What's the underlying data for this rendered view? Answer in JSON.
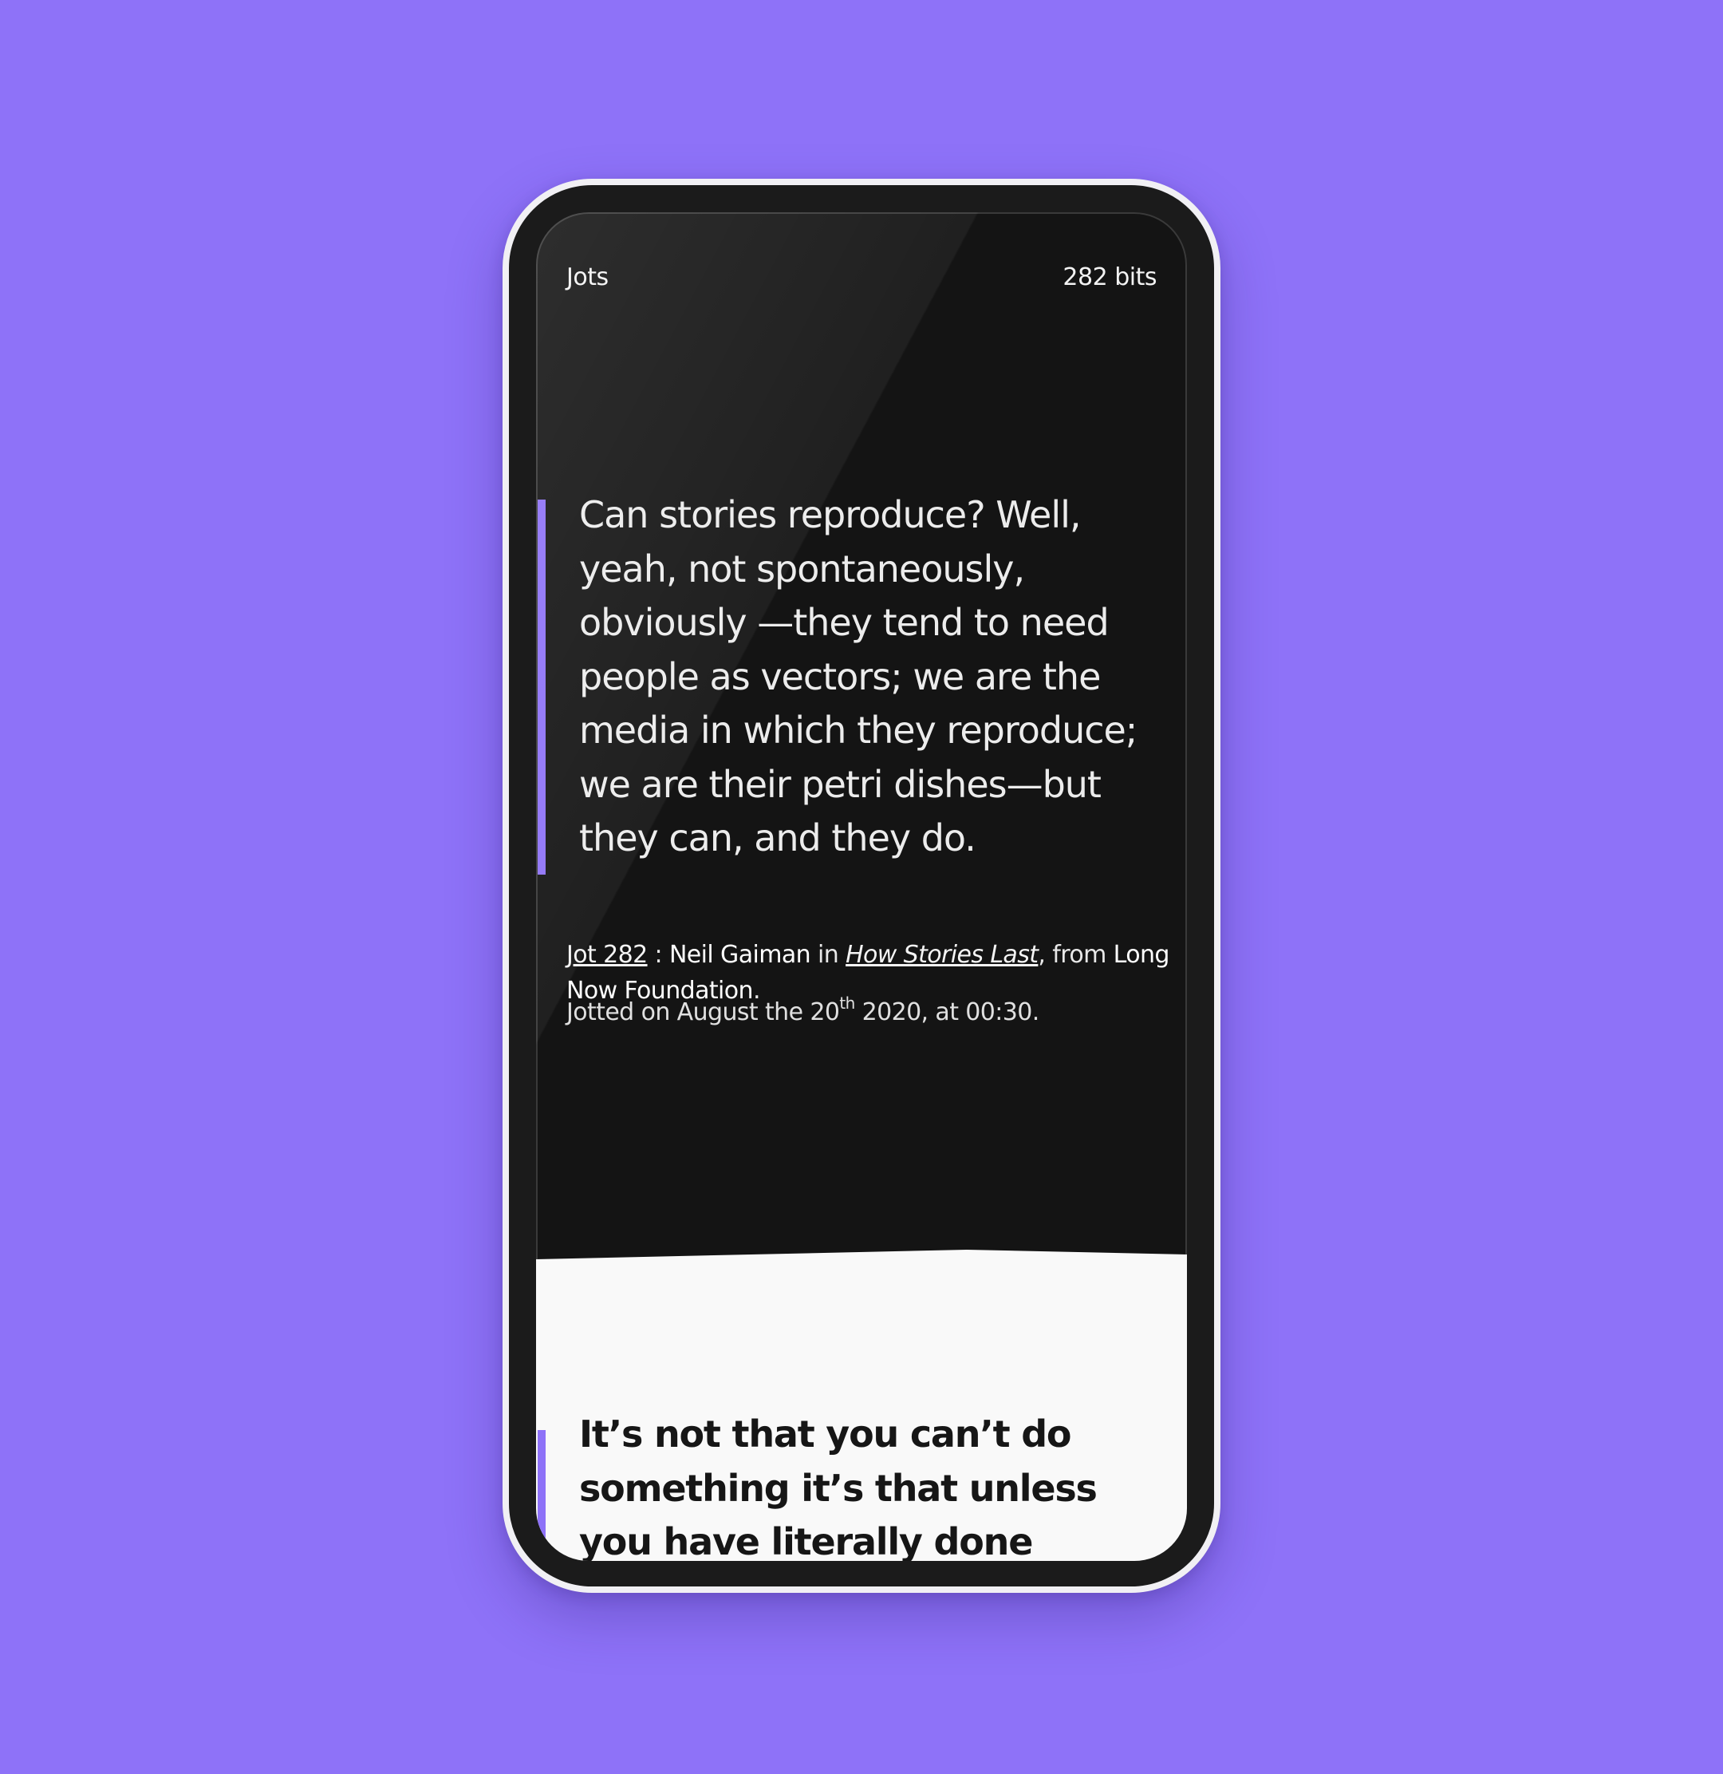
{
  "header": {
    "title": "Jots",
    "count": "282 bits"
  },
  "jot": {
    "quote": "Can stories reproduce? Well, yeah, not spontaneously, obviously —they tend to need people as vectors; we are the media in which they reproduce; we are their petri dishes—but they can, and they do.",
    "jot_link": "Jot 282",
    "sep": " : ",
    "author": "Neil Gaiman",
    "in_word": " in ",
    "work": "How Stories Last",
    "from_word": ", from ",
    "source": "Long Now Foundation",
    "end_dot": ".",
    "date_prefix": "Jotted on August the 20",
    "date_sup": "th",
    "date_suffix": " 2020, at 00:30."
  },
  "next_jot": {
    "quote": "It’s not that you can’t do something it’s that unless you have literally done everything,"
  },
  "colors": {
    "accent": "#8e72f8",
    "background": "#8e72f8",
    "screen_dark": "#141414",
    "screen_light": "#f9f9f9"
  }
}
